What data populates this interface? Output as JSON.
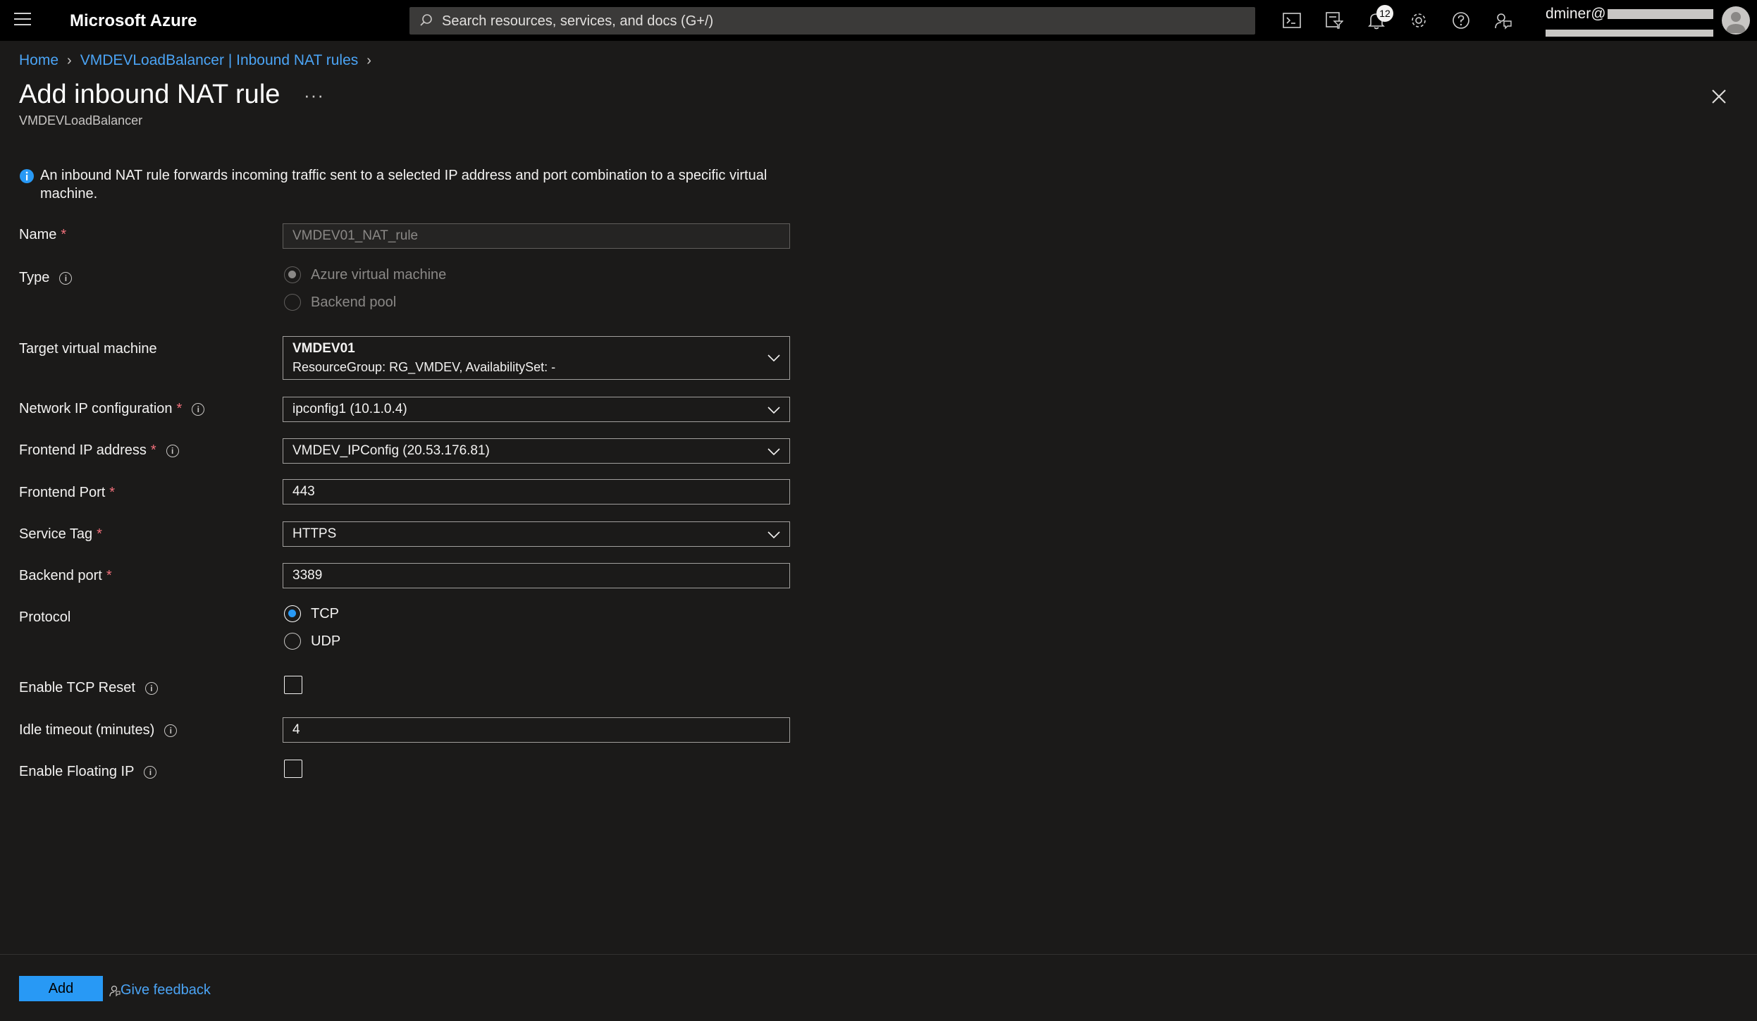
{
  "app": {
    "brand": "Microsoft Azure",
    "search_placeholder": "Search resources, services, and docs (G+/)",
    "notification_count": "12",
    "user_name": "dminer@"
  },
  "breadcrumb": {
    "items": [
      "Home",
      "VMDEVLoadBalancer | Inbound NAT rules"
    ]
  },
  "page": {
    "title": "Add inbound NAT rule",
    "more": "···",
    "subtitle": "VMDEVLoadBalancer",
    "info": "An inbound NAT rule forwards incoming traffic sent to a selected IP address and port combination to a specific virtual machine."
  },
  "form": {
    "name": {
      "label": "Name",
      "value": "VMDEV01_NAT_rule"
    },
    "type": {
      "label": "Type",
      "options": [
        "Azure virtual machine",
        "Backend pool"
      ],
      "selected": "Azure virtual machine"
    },
    "target_vm": {
      "label": "Target virtual machine",
      "value": "VMDEV01",
      "detail": "ResourceGroup: RG_VMDEV, AvailabilitySet: -"
    },
    "network_ip": {
      "label": "Network IP configuration",
      "value": "ipconfig1 (10.1.0.4)"
    },
    "frontend_ip": {
      "label": "Frontend IP address",
      "value": "VMDEV_IPConfig (20.53.176.81)"
    },
    "frontend_port": {
      "label": "Frontend Port",
      "value": "443"
    },
    "service_tag": {
      "label": "Service Tag",
      "value": "HTTPS"
    },
    "backend_port": {
      "label": "Backend port",
      "value": "3389"
    },
    "protocol": {
      "label": "Protocol",
      "options": [
        "TCP",
        "UDP"
      ],
      "selected": "TCP"
    },
    "tcp_reset": {
      "label": "Enable TCP Reset",
      "checked": false
    },
    "idle_timeout": {
      "label": "Idle timeout (minutes)",
      "value": "4"
    },
    "floating_ip": {
      "label": "Enable Floating IP",
      "checked": false
    }
  },
  "footer": {
    "add_label": "Add",
    "feedback_label": "Give feedback"
  },
  "colors": {
    "accent": "#2899f5",
    "link": "#4ba4f5",
    "required": "#f1707b",
    "background": "#1b1a19"
  }
}
